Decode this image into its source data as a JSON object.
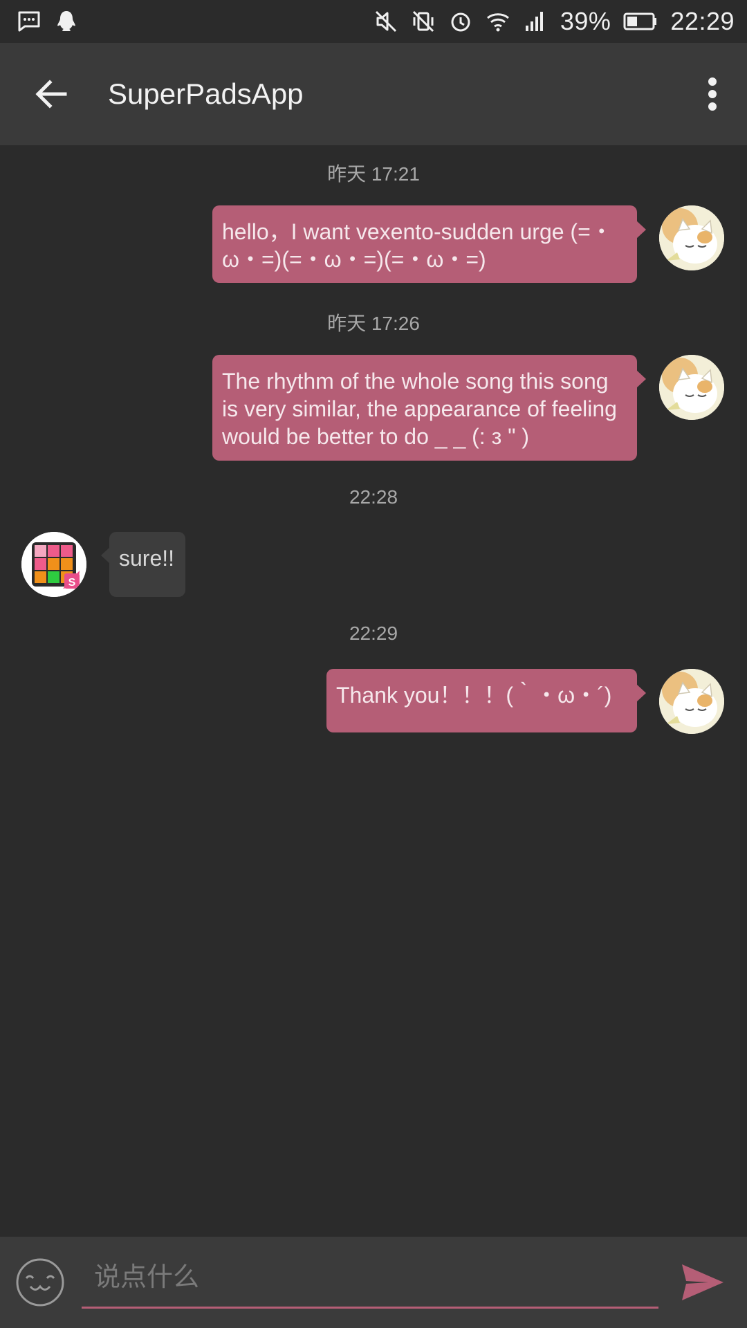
{
  "status_bar": {
    "battery_percent": "39%",
    "time": "22:29",
    "icons": [
      "message-icon",
      "qq-penguin-icon",
      "mute-icon",
      "vibrate-off-icon",
      "alarm-icon",
      "wifi-icon",
      "signal-icon",
      "battery-icon"
    ]
  },
  "app_bar": {
    "title": "SuperPadsApp",
    "back_icon": "arrow-back-icon",
    "menu_icon": "more-vert-icon"
  },
  "messages": [
    {
      "type": "timestamp",
      "text": "昨天 17:21"
    },
    {
      "type": "message",
      "sender": "me",
      "text": "hello，I want vexento-sudden urge (=・ω・=)(=・ω・=)(=・ω・=)"
    },
    {
      "type": "timestamp",
      "text": "昨天 17:26"
    },
    {
      "type": "message",
      "sender": "me",
      "text": "The rhythm of the whole song this song is very similar, the appearance of feeling would be better to do _ _ (: з \" )"
    },
    {
      "type": "timestamp",
      "text": "22:28"
    },
    {
      "type": "message",
      "sender": "app",
      "text": "sure!!"
    },
    {
      "type": "timestamp",
      "text": "22:29"
    },
    {
      "type": "message",
      "sender": "me",
      "text": "Thank you！！！(｀・ω・´)"
    }
  ],
  "input": {
    "placeholder": "说点什么",
    "value": ""
  },
  "colors": {
    "accent": "#b55e76",
    "background": "#2b2b2b",
    "app_bar": "#3a3a3a"
  }
}
